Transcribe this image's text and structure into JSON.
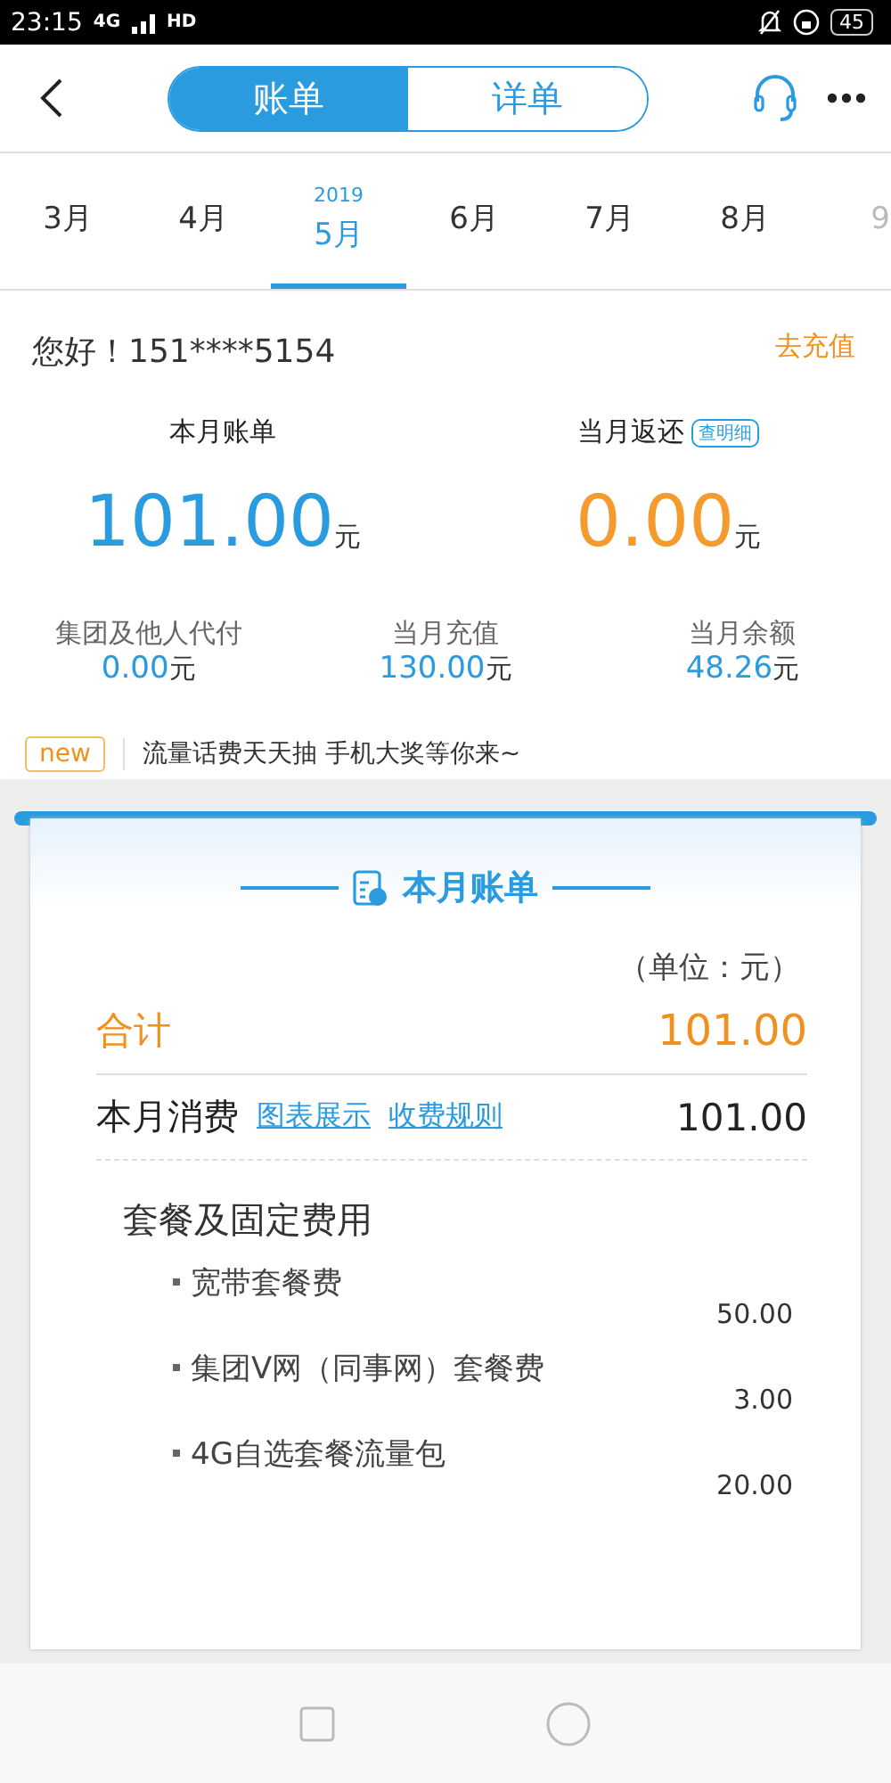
{
  "status_bar": {
    "time": "23:15",
    "network": "4G",
    "hd": "HD",
    "battery": "45"
  },
  "header": {
    "tabs": [
      {
        "label": "账单",
        "selected": true
      },
      {
        "label": "详单",
        "selected": false
      }
    ]
  },
  "months": [
    {
      "label": "3月",
      "selected": false
    },
    {
      "label": "4月",
      "selected": false
    },
    {
      "label": "5月",
      "selected": true,
      "year": "2019"
    },
    {
      "label": "6月",
      "selected": false
    },
    {
      "label": "7月",
      "selected": false
    },
    {
      "label": "8月",
      "selected": false
    },
    {
      "label": "9",
      "selected": false
    }
  ],
  "greeting": {
    "text": "您好！151****5154",
    "action": "去充值"
  },
  "summary": [
    {
      "label": "本月账单",
      "amount": "101.00",
      "unit": "元",
      "color": "#2b9be0"
    },
    {
      "label": "当月返还",
      "badge": "查明细",
      "amount": "0.00",
      "unit": "元",
      "color": "#f59a2c"
    }
  ],
  "stats": [
    {
      "label": "集团及他人代付",
      "value": "0.00",
      "unit": "元"
    },
    {
      "label": "当月充值",
      "value": "130.00",
      "unit": "元"
    },
    {
      "label": "当月余额",
      "value": "48.26",
      "unit": "元"
    }
  ],
  "notice": {
    "badge": "new",
    "text": "流量话费天天抽 手机大奖等你来~"
  },
  "bill": {
    "title": "本月账单",
    "unit_note": "（单位：元）",
    "total": {
      "label": "合计",
      "value": "101.00"
    },
    "consumption": {
      "label": "本月消费",
      "links": [
        "图表展示",
        "收费规则"
      ],
      "value": "101.00"
    },
    "section": {
      "title": "套餐及固定费用",
      "items": [
        {
          "name": "宽带套餐费",
          "value": "50.00"
        },
        {
          "name": "集团V网（同事网）套餐费",
          "value": "3.00"
        },
        {
          "name": "4G自选套餐流量包",
          "value": "20.00"
        }
      ]
    }
  }
}
